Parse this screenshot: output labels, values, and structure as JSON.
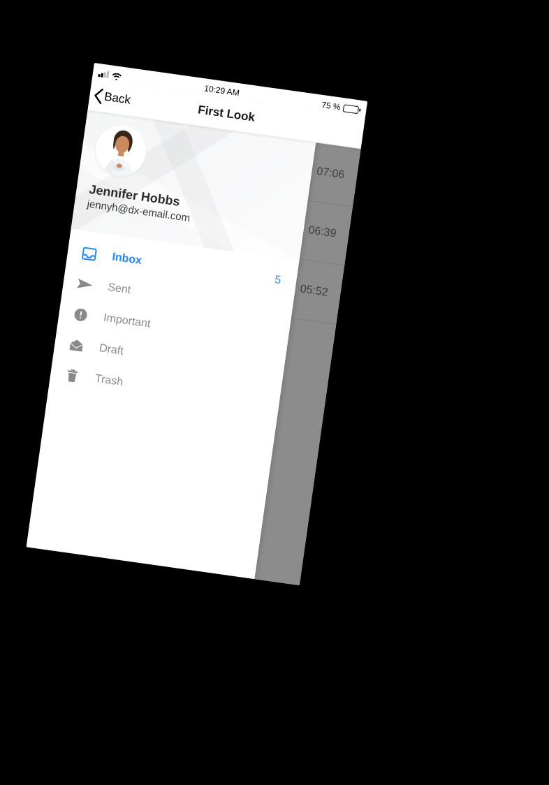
{
  "statusbar": {
    "time": "10:29 AM",
    "battery_text": "75 %"
  },
  "navbar": {
    "back_label": "Back",
    "title": "First Look"
  },
  "profile": {
    "name": "Jennifer Hobbs",
    "email": "jennyh@dx-email.com"
  },
  "menu": {
    "items": [
      {
        "label": "Inbox",
        "icon": "inbox-icon",
        "active": true,
        "badge": "5"
      },
      {
        "label": "Sent",
        "icon": "sent-icon",
        "active": false,
        "badge": ""
      },
      {
        "label": "Important",
        "icon": "important-icon",
        "active": false,
        "badge": ""
      },
      {
        "label": "Draft",
        "icon": "draft-icon",
        "active": false,
        "badge": ""
      },
      {
        "label": "Trash",
        "icon": "trash-icon",
        "active": false,
        "badge": ""
      }
    ]
  },
  "bg_list": {
    "times": [
      "07:06",
      "06:39",
      "05:52"
    ]
  },
  "colors": {
    "accent": "#1e88ff"
  }
}
